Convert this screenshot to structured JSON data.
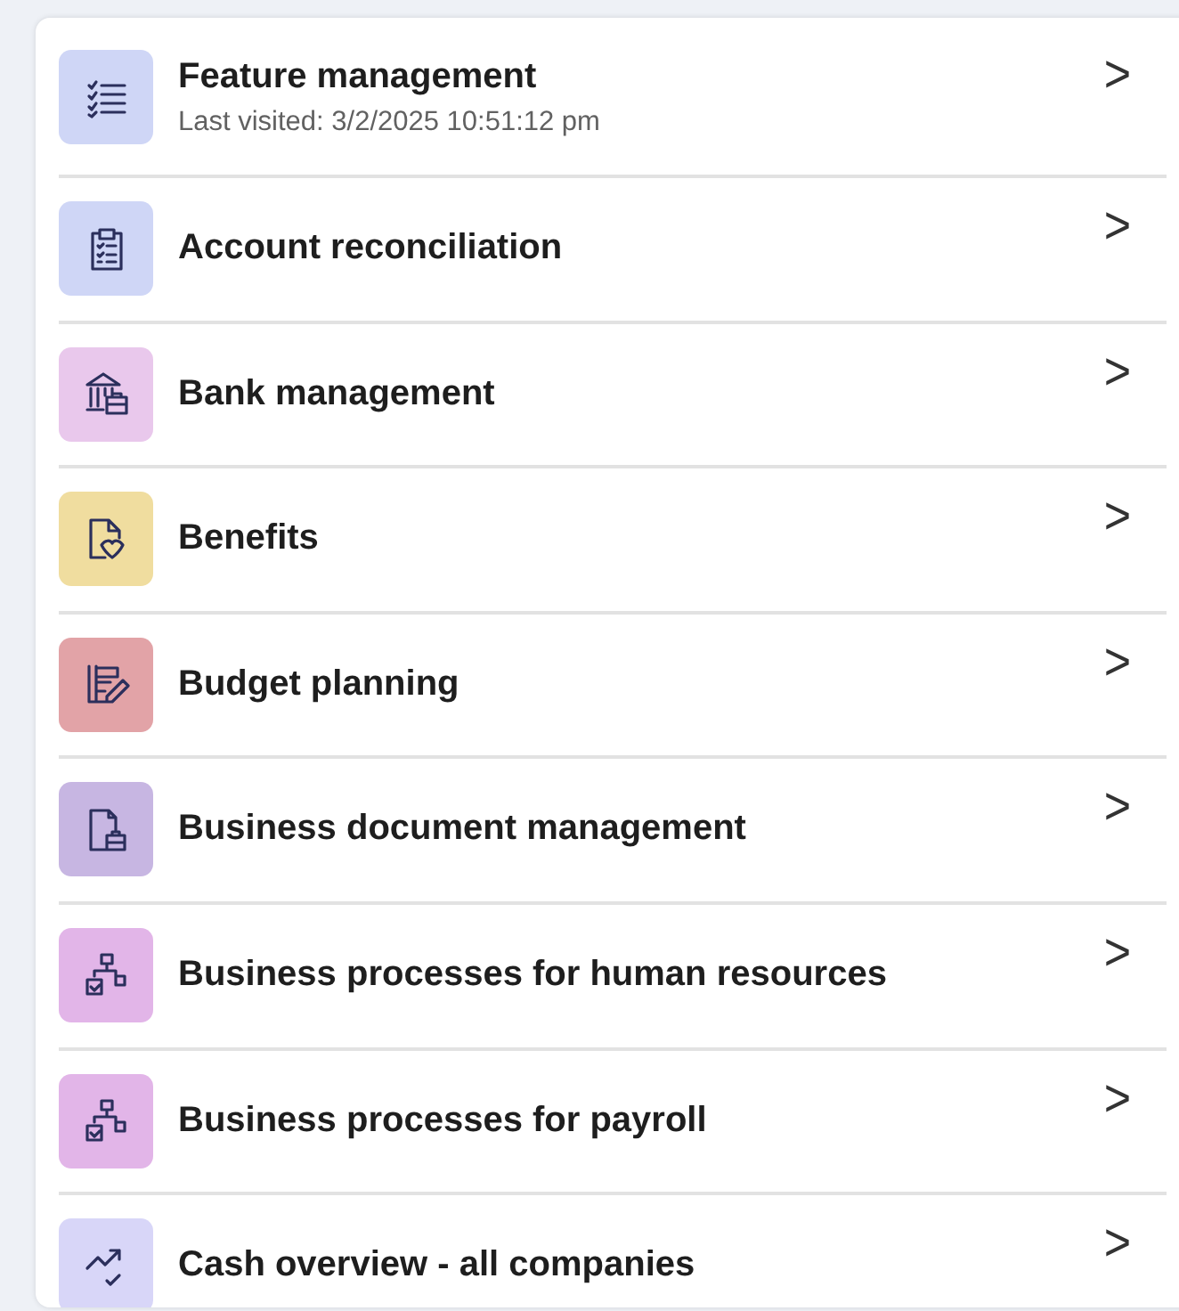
{
  "items": [
    {
      "title": "Feature management",
      "subtitle": "Last visited: 3/2/2025 10:51:12 pm",
      "kind": "list",
      "color": "#cfd6f6",
      "chevron": ">"
    },
    {
      "title": "Account reconciliation",
      "kind": "clipboard",
      "color": "#cfd6f6",
      "chevron": ">"
    },
    {
      "title": "Bank management",
      "kind": "bank",
      "color": "#e9c8ec",
      "chevron": ">"
    },
    {
      "title": "Benefits",
      "kind": "benefits",
      "color": "#f0dd9f",
      "chevron": ">"
    },
    {
      "title": "Budget planning",
      "kind": "budget",
      "color": "#e2a3a7",
      "chevron": ">"
    },
    {
      "title": "Business document management",
      "kind": "document",
      "color": "#c7b6e2",
      "chevron": ">"
    },
    {
      "title": "Business processes for human resources",
      "kind": "process",
      "color": "#e2b5e8",
      "chevron": ">"
    },
    {
      "title": "Business processes for payroll",
      "kind": "process",
      "color": "#e2b5e8",
      "chevron": ">"
    },
    {
      "title": "Cash overview - all companies",
      "kind": "trend",
      "color": "#d8d6f8",
      "chevron": ">"
    }
  ]
}
